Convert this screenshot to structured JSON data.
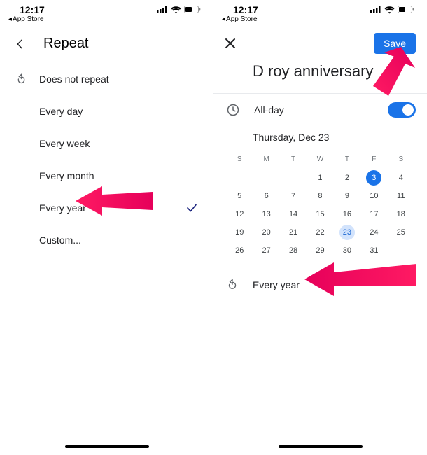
{
  "status": {
    "time": "12:17",
    "back": "App Store"
  },
  "left": {
    "title": "Repeat",
    "options": [
      "Does not repeat",
      "Every day",
      "Every week",
      "Every month",
      "Every year",
      "Custom..."
    ],
    "selected_index": 4
  },
  "right": {
    "save": "Save",
    "event_title": "D roy anniversary",
    "allday_label": "All-day",
    "allday_on": true,
    "date_heading": "Thursday, Dec 23",
    "weekday_heads": [
      "S",
      "M",
      "T",
      "W",
      "T",
      "F",
      "S"
    ],
    "weeks": [
      [
        "",
        "",
        "",
        "1",
        "2",
        "3",
        "4"
      ],
      [
        "5",
        "6",
        "7",
        "8",
        "9",
        "10",
        "11"
      ],
      [
        "12",
        "13",
        "14",
        "15",
        "16",
        "17",
        "18"
      ],
      [
        "19",
        "20",
        "21",
        "22",
        "23",
        "24",
        "25"
      ],
      [
        "26",
        "27",
        "28",
        "29",
        "30",
        "31",
        ""
      ]
    ],
    "selected_day": "3",
    "soft_day": "23",
    "repeat_label": "Every year"
  }
}
